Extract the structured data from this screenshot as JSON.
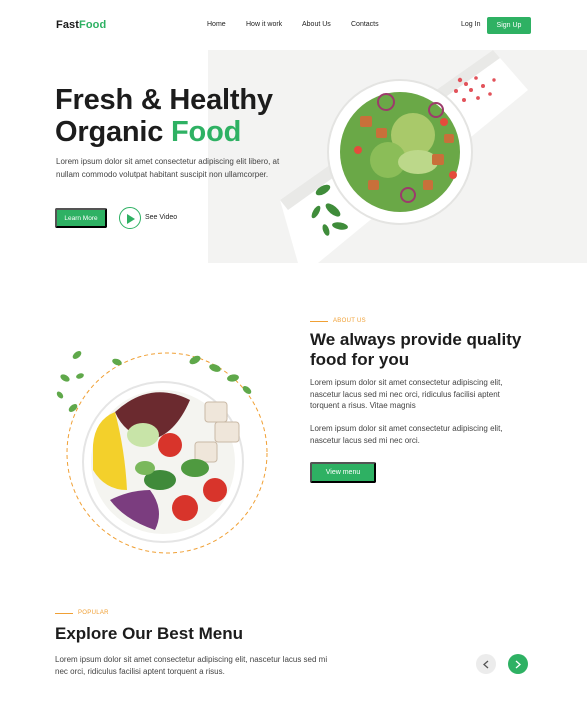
{
  "nav": {
    "logo_part1": "Fast",
    "logo_part2": "Food",
    "links": [
      "Home",
      "How it work",
      "About Us",
      "Contacts"
    ],
    "login": "Log In",
    "signup": "Sign Up"
  },
  "hero": {
    "title_line1": "Fresh & Healthy",
    "title_line2_a": "Organic ",
    "title_line2_b": "Food",
    "description": "Lorem ipsum dolor sit amet consectetur adipiscing elit libero, at nullam commodo volutpat habitant suscipit non ullamcorper.",
    "learn_more": "Learn More",
    "see_video": "See Video"
  },
  "about": {
    "kicker": "ABOUT US",
    "title": "We always provide quality food for you",
    "paragraph1": "Lorem ipsum dolor sit amet consectetur adipiscing elit, nascetur lacus sed mi nec orci, ridiculus facilisi aptent torquent a risus. Vitae magnis",
    "paragraph2": "Lorem ipsum dolor sit amet consectetur adipiscing elit, nascetur lacus sed mi nec orci.",
    "button": "View menu"
  },
  "popular": {
    "kicker": "POPULAR",
    "title": "Explore Our Best Menu",
    "description": "Lorem ipsum dolor sit amet consectetur adipiscing elit, nascetur lacus sed mi nec orci, ridiculus facilisi aptent torquent a risus.",
    "prev_icon": "chevron-left-icon",
    "next_icon": "chevron-right-icon"
  },
  "colors": {
    "brand_green": "#2eb163",
    "accent_orange": "#f0a035",
    "text_dark": "#1c1c1c"
  }
}
